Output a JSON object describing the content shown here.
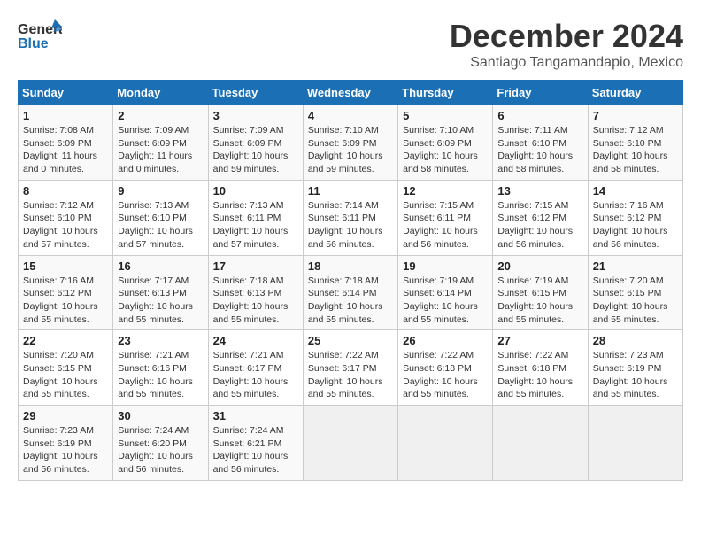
{
  "header": {
    "logo_general": "General",
    "logo_blue": "Blue",
    "month_title": "December 2024",
    "subtitle": "Santiago Tangamandapio, Mexico"
  },
  "weekdays": [
    "Sunday",
    "Monday",
    "Tuesday",
    "Wednesday",
    "Thursday",
    "Friday",
    "Saturday"
  ],
  "weeks": [
    [
      {
        "day": "1",
        "sunrise": "7:08 AM",
        "sunset": "6:09 PM",
        "daylight": "11 hours and 0 minutes."
      },
      {
        "day": "2",
        "sunrise": "7:09 AM",
        "sunset": "6:09 PM",
        "daylight": "11 hours and 0 minutes."
      },
      {
        "day": "3",
        "sunrise": "7:09 AM",
        "sunset": "6:09 PM",
        "daylight": "10 hours and 59 minutes."
      },
      {
        "day": "4",
        "sunrise": "7:10 AM",
        "sunset": "6:09 PM",
        "daylight": "10 hours and 59 minutes."
      },
      {
        "day": "5",
        "sunrise": "7:10 AM",
        "sunset": "6:09 PM",
        "daylight": "10 hours and 58 minutes."
      },
      {
        "day": "6",
        "sunrise": "7:11 AM",
        "sunset": "6:10 PM",
        "daylight": "10 hours and 58 minutes."
      },
      {
        "day": "7",
        "sunrise": "7:12 AM",
        "sunset": "6:10 PM",
        "daylight": "10 hours and 58 minutes."
      }
    ],
    [
      {
        "day": "8",
        "sunrise": "7:12 AM",
        "sunset": "6:10 PM",
        "daylight": "10 hours and 57 minutes."
      },
      {
        "day": "9",
        "sunrise": "7:13 AM",
        "sunset": "6:10 PM",
        "daylight": "10 hours and 57 minutes."
      },
      {
        "day": "10",
        "sunrise": "7:13 AM",
        "sunset": "6:11 PM",
        "daylight": "10 hours and 57 minutes."
      },
      {
        "day": "11",
        "sunrise": "7:14 AM",
        "sunset": "6:11 PM",
        "daylight": "10 hours and 56 minutes."
      },
      {
        "day": "12",
        "sunrise": "7:15 AM",
        "sunset": "6:11 PM",
        "daylight": "10 hours and 56 minutes."
      },
      {
        "day": "13",
        "sunrise": "7:15 AM",
        "sunset": "6:12 PM",
        "daylight": "10 hours and 56 minutes."
      },
      {
        "day": "14",
        "sunrise": "7:16 AM",
        "sunset": "6:12 PM",
        "daylight": "10 hours and 56 minutes."
      }
    ],
    [
      {
        "day": "15",
        "sunrise": "7:16 AM",
        "sunset": "6:12 PM",
        "daylight": "10 hours and 55 minutes."
      },
      {
        "day": "16",
        "sunrise": "7:17 AM",
        "sunset": "6:13 PM",
        "daylight": "10 hours and 55 minutes."
      },
      {
        "day": "17",
        "sunrise": "7:18 AM",
        "sunset": "6:13 PM",
        "daylight": "10 hours and 55 minutes."
      },
      {
        "day": "18",
        "sunrise": "7:18 AM",
        "sunset": "6:14 PM",
        "daylight": "10 hours and 55 minutes."
      },
      {
        "day": "19",
        "sunrise": "7:19 AM",
        "sunset": "6:14 PM",
        "daylight": "10 hours and 55 minutes."
      },
      {
        "day": "20",
        "sunrise": "7:19 AM",
        "sunset": "6:15 PM",
        "daylight": "10 hours and 55 minutes."
      },
      {
        "day": "21",
        "sunrise": "7:20 AM",
        "sunset": "6:15 PM",
        "daylight": "10 hours and 55 minutes."
      }
    ],
    [
      {
        "day": "22",
        "sunrise": "7:20 AM",
        "sunset": "6:15 PM",
        "daylight": "10 hours and 55 minutes."
      },
      {
        "day": "23",
        "sunrise": "7:21 AM",
        "sunset": "6:16 PM",
        "daylight": "10 hours and 55 minutes."
      },
      {
        "day": "24",
        "sunrise": "7:21 AM",
        "sunset": "6:17 PM",
        "daylight": "10 hours and 55 minutes."
      },
      {
        "day": "25",
        "sunrise": "7:22 AM",
        "sunset": "6:17 PM",
        "daylight": "10 hours and 55 minutes."
      },
      {
        "day": "26",
        "sunrise": "7:22 AM",
        "sunset": "6:18 PM",
        "daylight": "10 hours and 55 minutes."
      },
      {
        "day": "27",
        "sunrise": "7:22 AM",
        "sunset": "6:18 PM",
        "daylight": "10 hours and 55 minutes."
      },
      {
        "day": "28",
        "sunrise": "7:23 AM",
        "sunset": "6:19 PM",
        "daylight": "10 hours and 55 minutes."
      }
    ],
    [
      {
        "day": "29",
        "sunrise": "7:23 AM",
        "sunset": "6:19 PM",
        "daylight": "10 hours and 56 minutes."
      },
      {
        "day": "30",
        "sunrise": "7:24 AM",
        "sunset": "6:20 PM",
        "daylight": "10 hours and 56 minutes."
      },
      {
        "day": "31",
        "sunrise": "7:24 AM",
        "sunset": "6:21 PM",
        "daylight": "10 hours and 56 minutes."
      },
      null,
      null,
      null,
      null
    ]
  ],
  "labels": {
    "sunrise": "Sunrise:",
    "sunset": "Sunset:",
    "daylight": "Daylight:"
  }
}
